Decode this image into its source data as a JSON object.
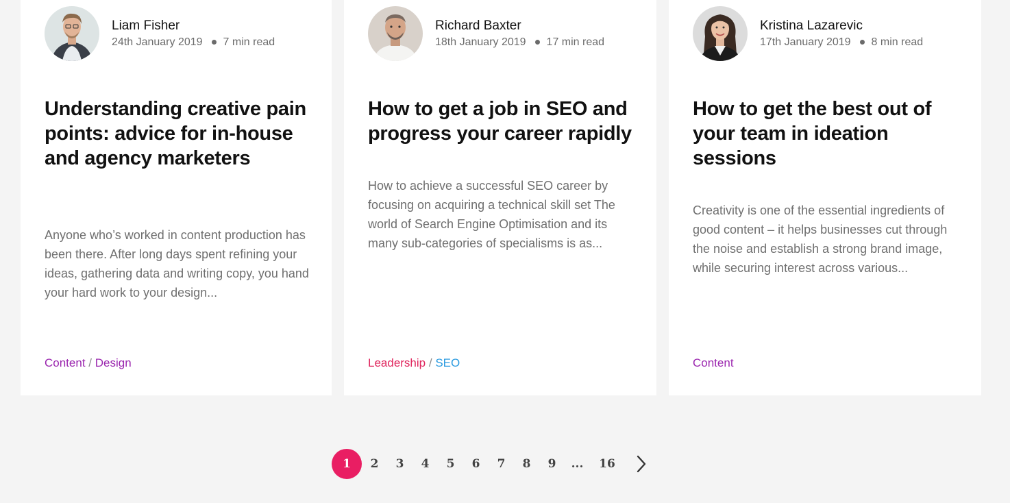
{
  "posts": [
    {
      "author": "Liam Fisher",
      "date": "24th January 2019",
      "read_time": "7 min read",
      "title": "Understanding creative pain points: advice for in-house and agency marketers",
      "excerpt": "Anyone who’s worked in content production has been there. After long days spent refining your ideas, gathering data and writing copy, you hand your hard work to your design...",
      "tags": [
        {
          "label": "Content",
          "color": "#9b27af"
        },
        {
          "label": "Design",
          "color": "#9b27af"
        }
      ]
    },
    {
      "author": "Richard Baxter",
      "date": "18th January 2019",
      "read_time": "17 min read",
      "title": "How to get a job in SEO and progress your career rapidly",
      "excerpt": "How to achieve a successful SEO career by focusing on acquiring a technical skill set The world of Search Engine Optimisation and its many sub-categories of specialisms is as...",
      "tags": [
        {
          "label": "Leadership",
          "color": "#e0265e"
        },
        {
          "label": "SEO",
          "color": "#2b9be0"
        }
      ]
    },
    {
      "author": "Kristina Lazarevic",
      "date": "17th January 2019",
      "read_time": "8 min read",
      "title": "How to get the best out of your team in ideation sessions",
      "excerpt": "Creativity is one of the essential ingredients of good content – it helps businesses cut through the noise and establish a strong brand image, while securing interest across various...",
      "tags": [
        {
          "label": "Content",
          "color": "#9b27af"
        }
      ]
    }
  ],
  "tag_separator": "/",
  "pagination": {
    "current": "1",
    "pages": [
      "2",
      "3",
      "4",
      "5",
      "6",
      "7",
      "8",
      "9"
    ],
    "ellipsis": "...",
    "last": "16",
    "next_icon": "chevron-right-icon",
    "accent_color": "#e91e63"
  }
}
